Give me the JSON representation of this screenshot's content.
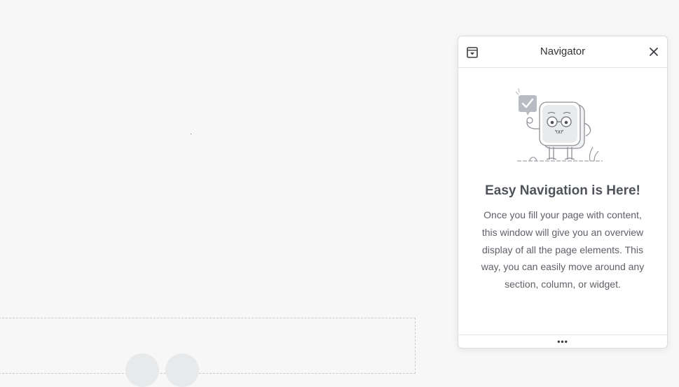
{
  "canvas": {
    "background": "#f7f7f7"
  },
  "navigator": {
    "title": "Navigator",
    "collapse_icon": "collapse-square-icon",
    "close_icon": "close-icon",
    "illustration": "mascot-checkmark-illustration",
    "empty_state": {
      "heading": "Easy Navigation is Here!",
      "description": "Once you fill your page with content, this window will give you an overview display of all the page elements. This way, you can easily move around any section, column, or widget."
    },
    "footer": {
      "handle": "•••",
      "handle_icon": "ellipsis-resize-icon"
    }
  },
  "colors": {
    "panel_border": "#dcdde0",
    "heading": "#4f535a",
    "text": "#5e6168",
    "dashed_border": "#c9cacc"
  }
}
